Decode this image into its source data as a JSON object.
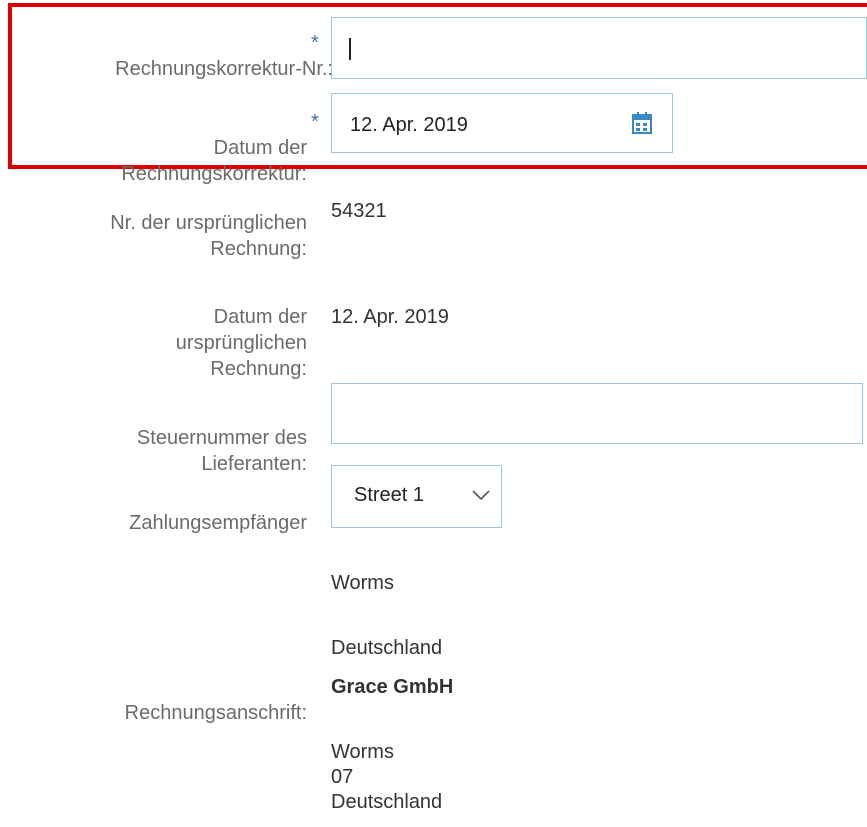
{
  "fields": {
    "correction_no": {
      "label": "Rechnungskorrektur-Nr.:",
      "required_mark": "*",
      "value": ""
    },
    "correction_date": {
      "label": "Datum der\nRechnungskorrektur:",
      "required_mark": "*",
      "value": "12. Apr. 2019",
      "icon": "calendar-icon"
    },
    "original_no": {
      "label": "Nr. der ursprünglichen\nRechnung:",
      "value": "54321"
    },
    "original_date": {
      "label": "Datum der\nursprünglichen\nRechnung:",
      "value": "12. Apr. 2019"
    },
    "tax_no": {
      "label": "Steuernummer des\nLieferanten:",
      "value": ""
    },
    "payee": {
      "label": "Zahlungsempfänger",
      "value": "Street 1",
      "icon": "chevron-down-icon"
    }
  },
  "payee_address": {
    "city": "Worms",
    "country": "Deutschland"
  },
  "billing": {
    "label": "Rechnungsanschrift:",
    "company": "Grace GmbH",
    "city": "Worms",
    "code": "07",
    "country": "Deutschland"
  },
  "colors": {
    "highlight": "#e00000",
    "input_border": "#9cc7e2",
    "required": "#3e6fa8",
    "label": "#6b6b6b"
  }
}
